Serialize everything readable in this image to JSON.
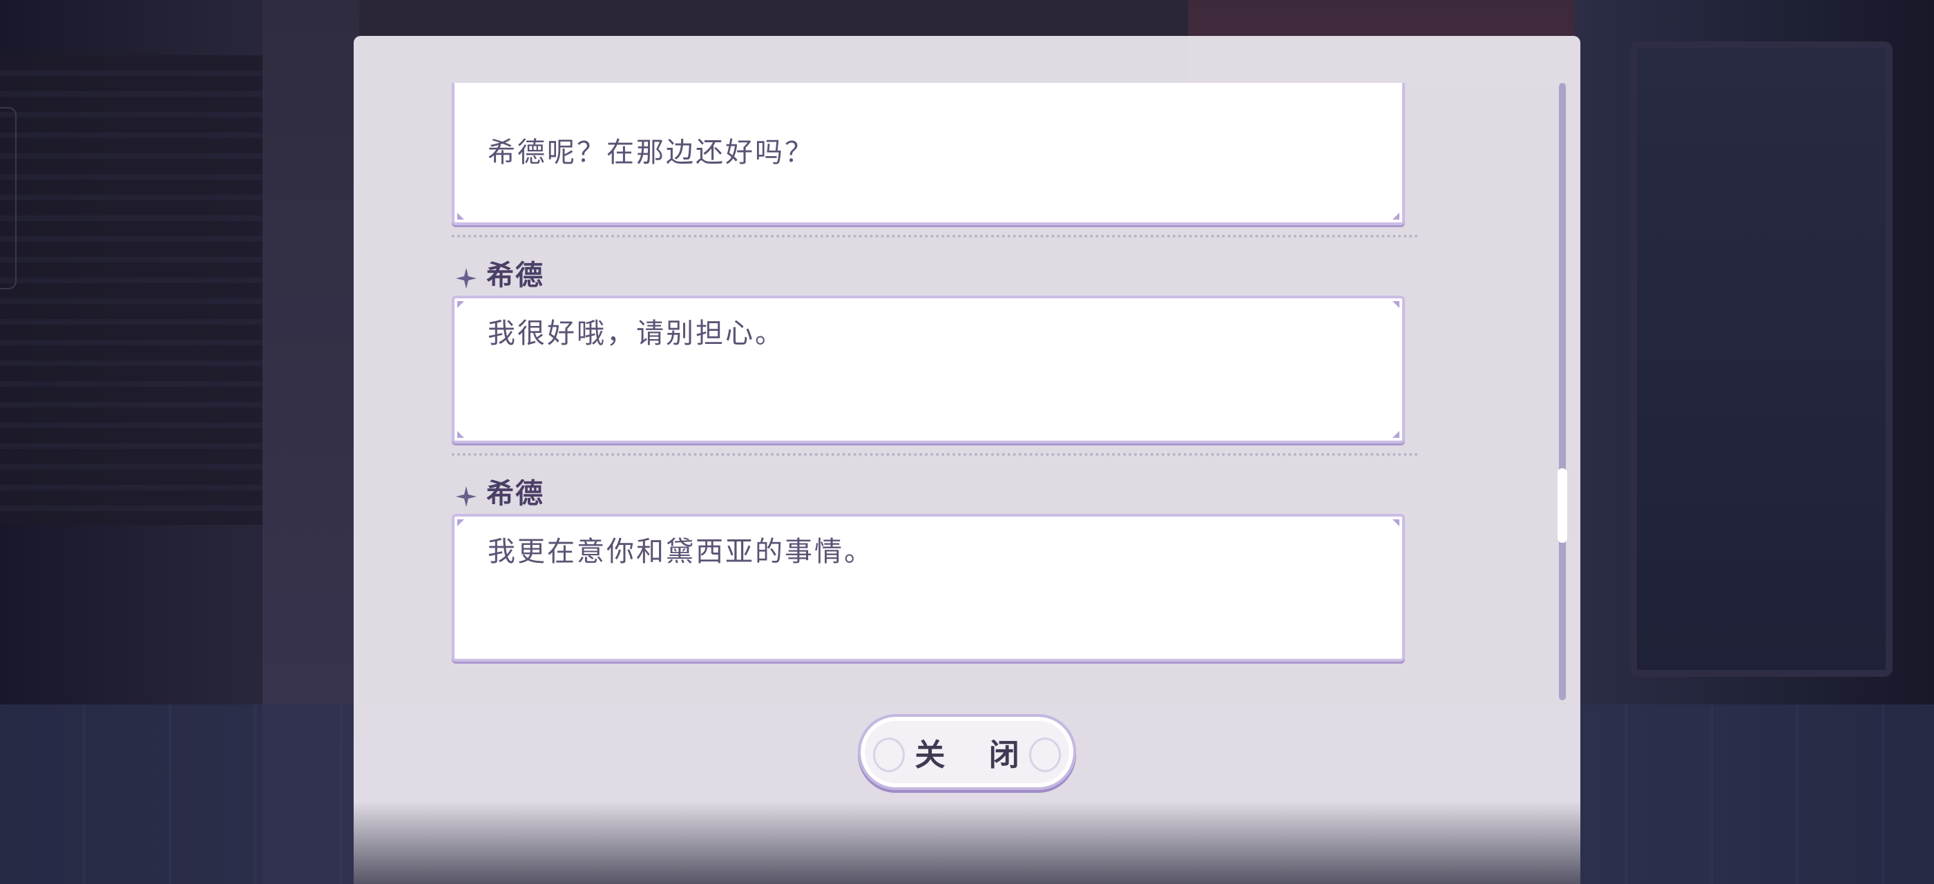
{
  "log": {
    "entries": [
      {
        "speaker": "",
        "text": "希德呢？在那边还好吗？"
      },
      {
        "speaker": "希德",
        "text": "我很好哦，请别担心。"
      },
      {
        "speaker": "希德",
        "text": "我更在意你和黛西亚的事情。"
      }
    ],
    "scroll_position": 0.71
  },
  "buttons": {
    "close_label": "关 闭"
  },
  "colors": {
    "panel_bg": "#e8e3ea",
    "bubble_border": "#cbbde6",
    "speaker_text": "#4a3f66",
    "dialogue_text": "#5c5274",
    "scroll_track": "#a9a3c8"
  },
  "icons": {
    "speaker_marker": "four-point-star-icon"
  }
}
